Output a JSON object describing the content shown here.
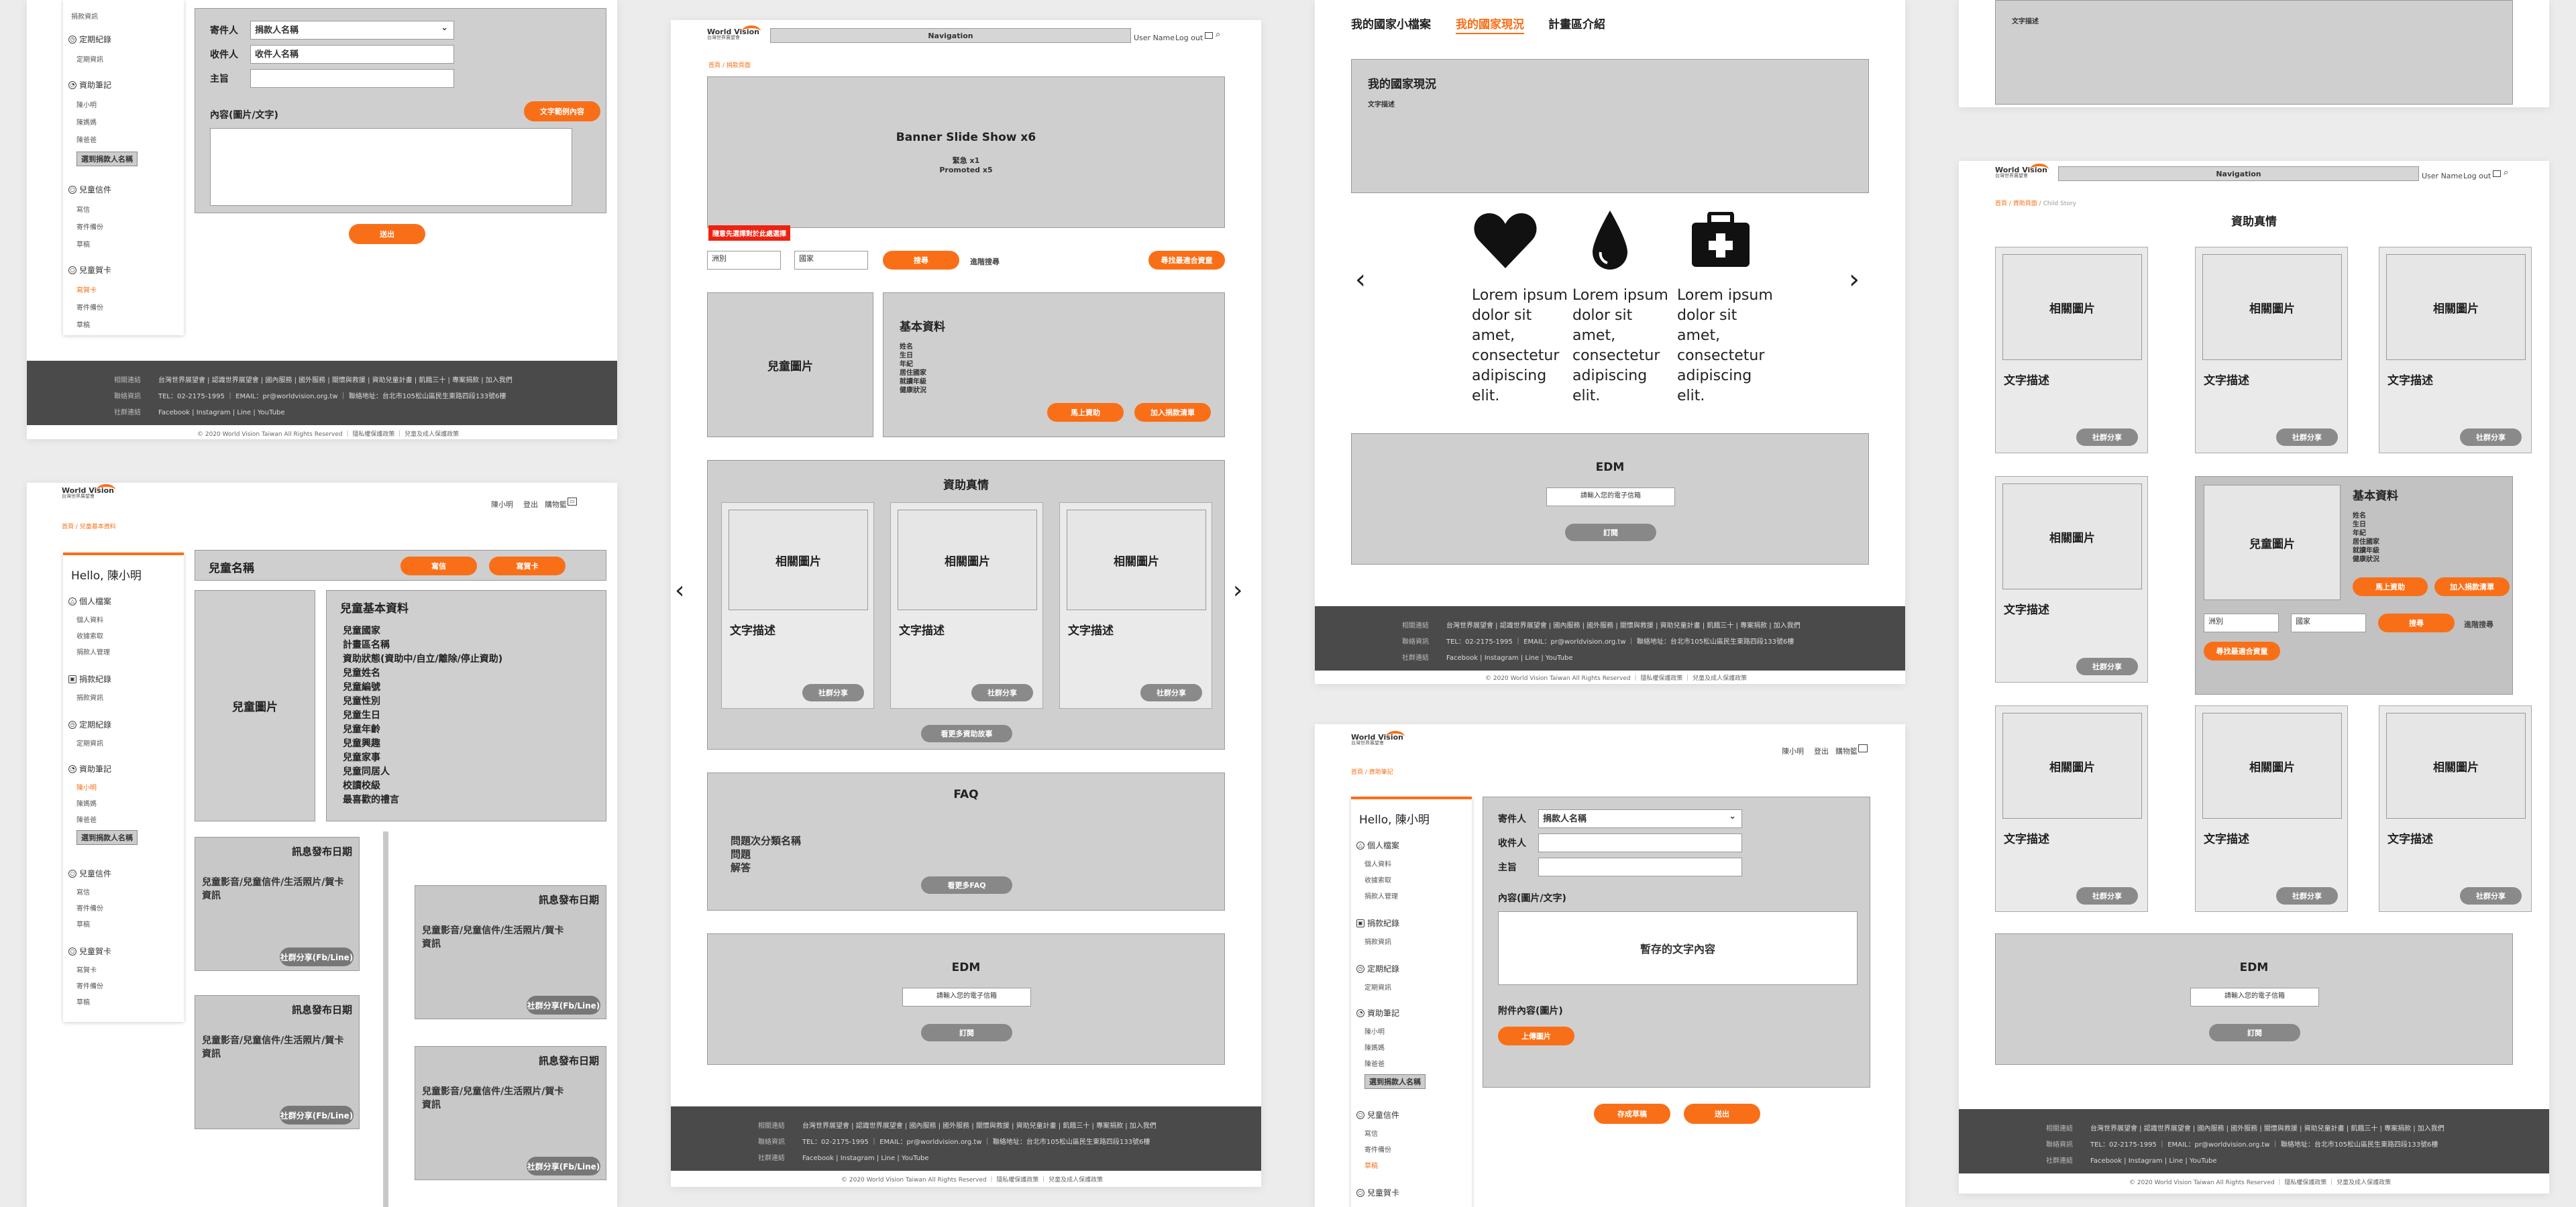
{
  "common": {
    "logo_line1": "World Vision",
    "logo_line2": "台灣世界展望會",
    "navigation": "Navigation",
    "user_name": "User Name",
    "logout": "Log out",
    "crumb_home": "首頁",
    "crumb_sep": "/",
    "user_chen": "陳小明",
    "logout_zh": "登出",
    "shopping": "購物籃",
    "footer": {
      "links_label": "相關連結",
      "links": "台灣世界展望會 | 認識世界展望會 | 國內服務 | 國外服務 | 關懷與救援 | 資助兒童計畫 | 飢餓三十 | 專案捐款 | 加入我們",
      "contact_label": "聯絡資訊",
      "contact": "TEL：02-2175-1995 ｜ EMAIL：pr@worldvision.org.tw ｜ 聯絡地址：台北市105松山區民生東路四段133號6樓",
      "social_label": "社群連結",
      "social": "Facebook | Instagram | Line | YouTube",
      "copyright": "© 2020 World Vision Taiwan All Rights Reserved ｜ 隱私權保護政策 ｜ 兒童及成人保護政策"
    },
    "edm": {
      "title": "EDM",
      "placeholder": "請輸入您的電子信箱",
      "subscribe": "訂閱"
    }
  },
  "sidebar": {
    "hello": "Hello, 陳小明",
    "profile": "個人檔案",
    "profile_items": [
      "個人資料",
      "收據索取",
      "捐款人管理"
    ],
    "donation": "捐款紀錄",
    "donation_items": [
      "捐款資訊"
    ],
    "regular": "定期紀錄",
    "regular_items": [
      "定期資訊"
    ],
    "sponsor": "資助筆記",
    "sponsor_items": [
      "陳小明",
      "陳媽媽",
      "陳爸爸"
    ],
    "switch_chip": "選到捐款人名稱",
    "child_letters": "兒童信件",
    "letter_items": [
      "寫信",
      "寄件備份",
      "草稿"
    ],
    "child_cards": "兒童賀卡",
    "card_items": [
      "寫賀卡",
      "寄件備份",
      "草稿"
    ]
  },
  "compose": {
    "sender_label": "寄件人",
    "sender_value": "捐款人名稱",
    "recipient_label": "收件人",
    "recipient_value": "收件人名稱",
    "subject_label": "主旨",
    "content_label": "內容(圖片/文字)",
    "template_btn": "文字範例內容",
    "send": "送出",
    "draft_text": "暫存的文字內容",
    "attach_label": "附件內容(圖片)",
    "upload": "上傳圖片",
    "save_draft": "存成草稿"
  },
  "board2": {
    "child_name": "兒童名稱",
    "btn_letter": "寫信",
    "btn_card": "寫賀卡",
    "child_photo": "兒童圖片",
    "info_title": "兒童基本資料",
    "info_items": [
      "兒童國家",
      "計畫區名稱",
      "資助狀態(資助中/自立/離除/停止資助)",
      "兒童姓名",
      "兒童編號",
      "兒童性別",
      "兒童生日",
      "兒童年齡",
      "兒童興趣",
      "兒童家事",
      "兒童同居人",
      "校讀校級",
      "最喜歡的禮言"
    ],
    "post_date": "訊息發布日期",
    "post_body": "兒童影音/兒童信件/生活照片/賀卡資訊",
    "share": "社群分享(Fb/Line)"
  },
  "board3": {
    "crumb_page": "捐款頁面",
    "banner_title": "Banner Slide Show x6",
    "banner_sub1": "緊急 x1",
    "banner_sub2": "Promoted x5",
    "urgent_tag": "隨意先選擇對於此處選擇",
    "filter_country": "洲別",
    "filter_region": "國家",
    "search": "搜尋",
    "adv": "進階搜尋",
    "find_btn": "尋找最適合資童",
    "child_photo": "兒童圖片",
    "info_title": "基本資料",
    "info_items": [
      "姓名",
      "生日",
      "年紀",
      "居住國家",
      "就讀年級",
      "健康狀況"
    ],
    "sponsor_now": "馬上資助",
    "add_cart": "加入捐款清單",
    "story_title": "資助真情",
    "story_photo": "相關圖片",
    "story_text": "文字描述",
    "story_share": "社群分享",
    "more_stories": "看更多資助故事",
    "faq_title": "FAQ",
    "faq_lines": [
      "問題次分類名稱",
      "問題",
      "解答"
    ],
    "faq_more": "看更多FAQ"
  },
  "board4": {
    "tabs": [
      "我的國家小檔案",
      "我的國家現況",
      "計畫區介紹"
    ],
    "status_title": "我的國家現況",
    "status_desc": "文字描述",
    "lorem": "Lorem ipsum dolor sit amet, consectetur adipiscing elit."
  },
  "board5": {
    "crumb_page": "資助筆記"
  },
  "board6": {
    "top_desc": "文字描述",
    "crumb_page": "資助頁面",
    "crumb_child": "Child Story",
    "title": "資助真情"
  }
}
